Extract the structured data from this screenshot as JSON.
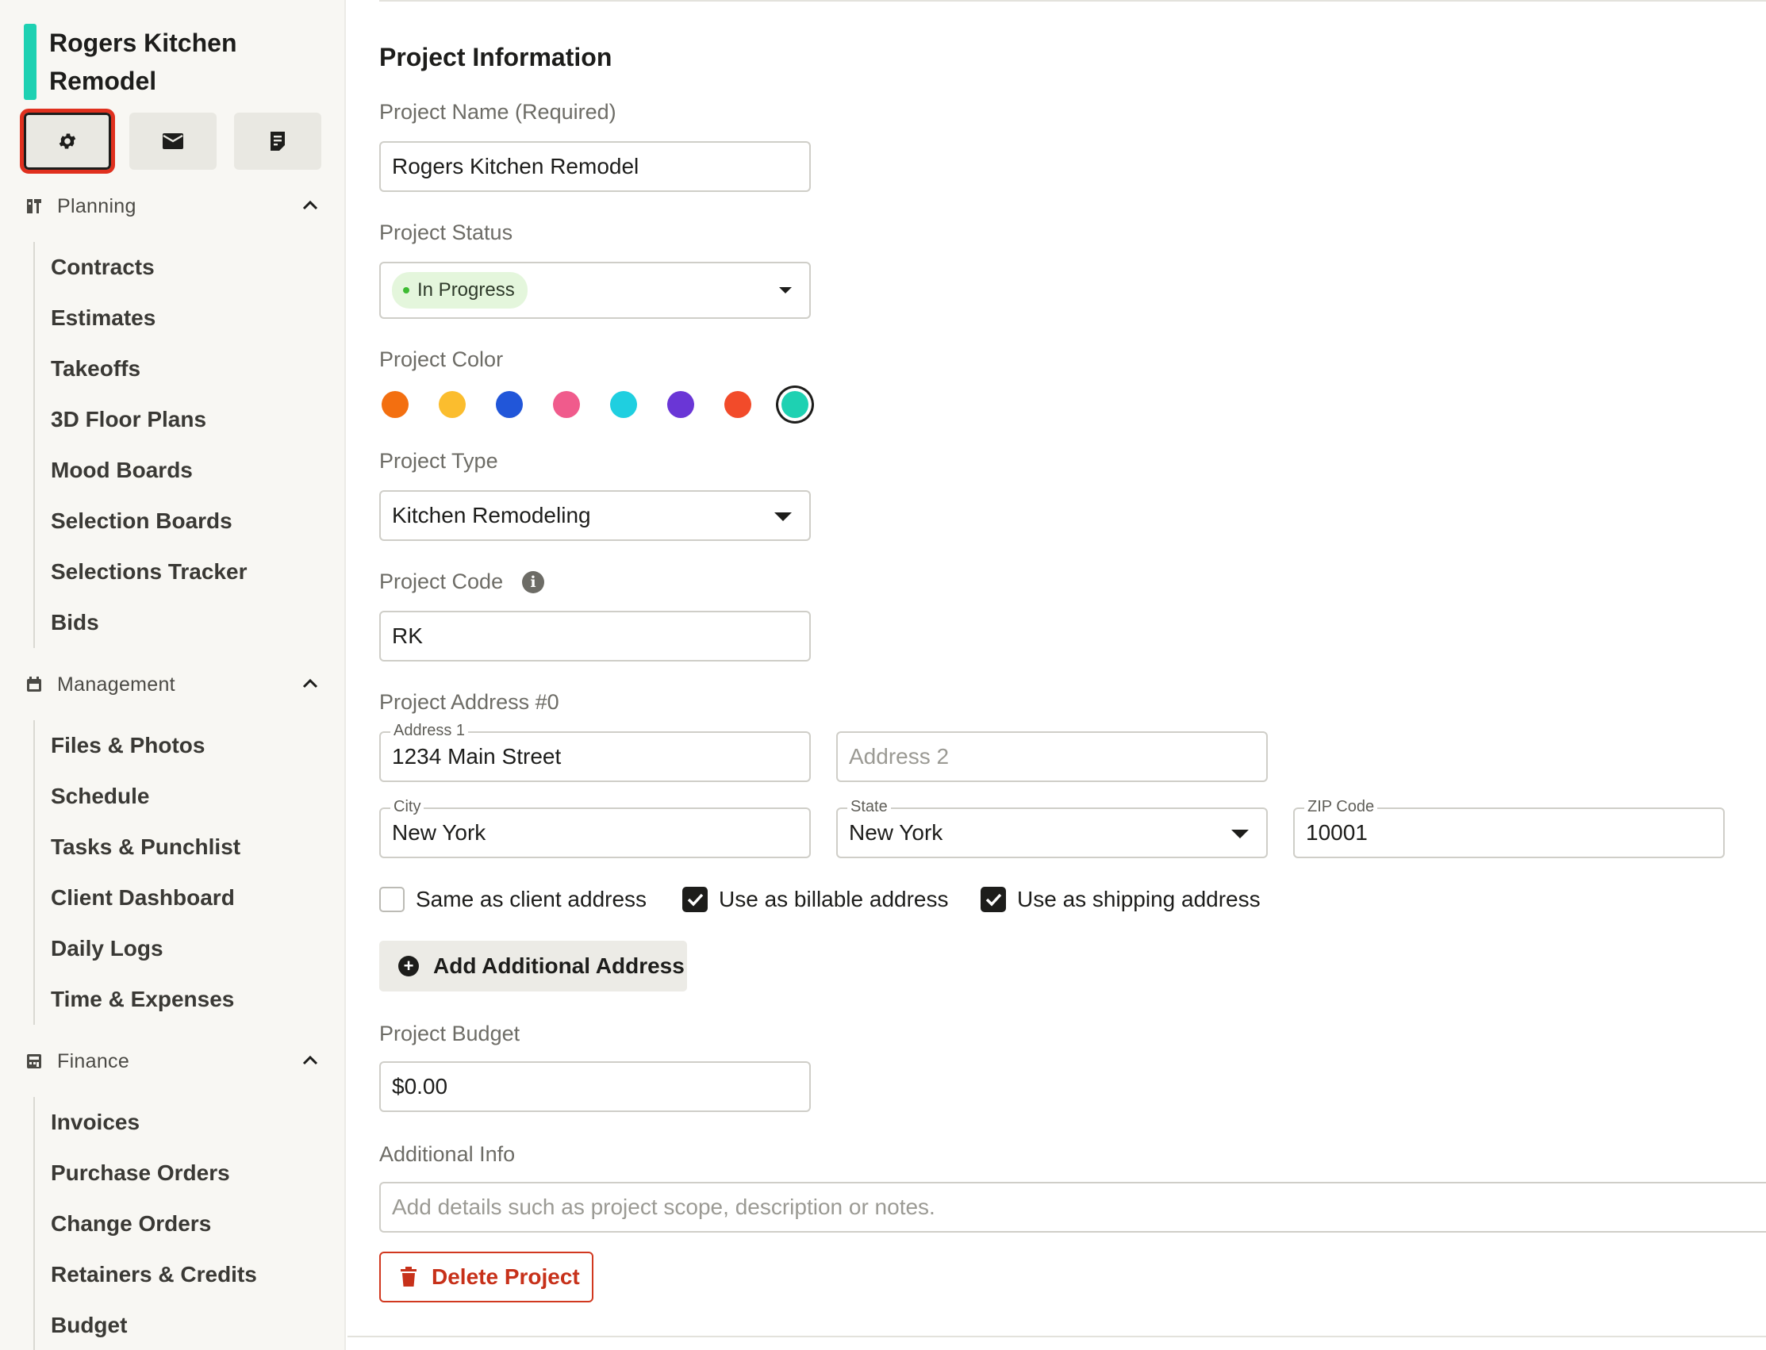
{
  "project": {
    "title": "Rogers Kitchen Remodel",
    "accent_color": "#1ed1b2"
  },
  "toolbar": {
    "buttons": [
      {
        "icon": "gear-icon",
        "active": true
      },
      {
        "icon": "mail-icon",
        "active": false
      },
      {
        "icon": "document-icon",
        "active": false
      }
    ]
  },
  "sidebar": {
    "planning": {
      "label": "Planning",
      "items": [
        "Contracts",
        "Estimates",
        "Takeoffs",
        "3D Floor Plans",
        "Mood Boards",
        "Selection Boards",
        "Selections Tracker",
        "Bids"
      ]
    },
    "management": {
      "label": "Management",
      "items": [
        "Files & Photos",
        "Schedule",
        "Tasks & Punchlist",
        "Client Dashboard",
        "Daily Logs",
        "Time & Expenses"
      ]
    },
    "finance": {
      "label": "Finance",
      "items": [
        "Invoices",
        "Purchase Orders",
        "Change Orders",
        "Retainers & Credits",
        "Budget"
      ]
    }
  },
  "form": {
    "heading": "Project Information",
    "name": {
      "label": "Project Name (Required)",
      "value": "Rogers Kitchen Remodel"
    },
    "status": {
      "label": "Project Status",
      "value": "In Progress",
      "dot_color": "#3dbb32"
    },
    "color": {
      "label": "Project Color",
      "options": [
        "#f36f10",
        "#fbbd2e",
        "#2156d9",
        "#f05b8c",
        "#1fcfe0",
        "#6a36d6",
        "#f24b2a",
        "#1ed1b2"
      ],
      "selected_index": 7
    },
    "type": {
      "label": "Project Type",
      "value": "Kitchen Remodeling"
    },
    "code": {
      "label": "Project Code",
      "value": "RK"
    },
    "address": {
      "label": "Project Address #0",
      "address1": {
        "label": "Address 1",
        "value": "1234 Main Street"
      },
      "address2": {
        "placeholder": "Address 2"
      },
      "city": {
        "label": "City",
        "value": "New York"
      },
      "state": {
        "label": "State",
        "value": "New York"
      },
      "zip": {
        "label": "ZIP Code",
        "value": "10001"
      },
      "same_as_client": {
        "label": "Same as client address",
        "checked": false
      },
      "billable": {
        "label": "Use as billable address",
        "checked": true
      },
      "shipping": {
        "label": "Use as shipping address",
        "checked": true
      }
    },
    "add_address_label": "Add Additional Address",
    "budget": {
      "label": "Project Budget",
      "value": "$0.00"
    },
    "additional_info": {
      "label": "Additional Info",
      "placeholder": "Add details such as project scope, description or notes."
    },
    "delete_label": "Delete Project"
  }
}
